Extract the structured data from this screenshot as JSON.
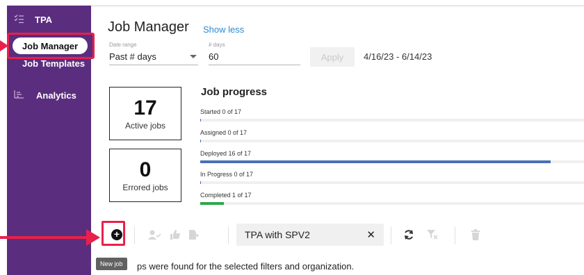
{
  "sidebar": {
    "app_name": "TPA",
    "items": [
      {
        "label": "Job Manager",
        "icon": "job-manager-icon"
      },
      {
        "label": "Job Templates",
        "icon": ""
      },
      {
        "label": "Analytics",
        "icon": "chart-icon"
      }
    ]
  },
  "header": {
    "title": "Job Manager",
    "show_less": "Show less"
  },
  "filters": {
    "date_range_label": "Date range",
    "date_range_value": "Past # days",
    "days_label": "# days",
    "days_value": "60",
    "apply_label": "Apply",
    "range_text": "4/16/23 - 6/14/23"
  },
  "stats": {
    "active": {
      "value": "17",
      "label": "Active jobs"
    },
    "errored": {
      "value": "0",
      "label": "Errored jobs"
    }
  },
  "progress": {
    "title": "Job progress",
    "rows": [
      {
        "label": "Started 0 of 17",
        "value": 0,
        "total": 17,
        "color": "#4a6fb5"
      },
      {
        "label": "Assigned 0 of 17",
        "value": 0,
        "total": 17,
        "color": "#4a6fb5"
      },
      {
        "label": "Deployed 16 of 17",
        "value": 16,
        "total": 17,
        "color": "#4a6fb5"
      },
      {
        "label": "In Progress 0 of 17",
        "value": 0,
        "total": 17,
        "color": "#4a6fb5"
      },
      {
        "label": "Completed 1 of 17",
        "value": 1,
        "total": 17,
        "color": "#2ea84a"
      }
    ]
  },
  "toolbar": {
    "filter_chip": "TPA with SPV2",
    "tooltip": "New job",
    "empty_message": "ps were found for the selected filters and organization."
  },
  "colors": {
    "sidebar": "#5b2d7f",
    "highlight": "#e8204a",
    "link": "#2a8ad4"
  }
}
